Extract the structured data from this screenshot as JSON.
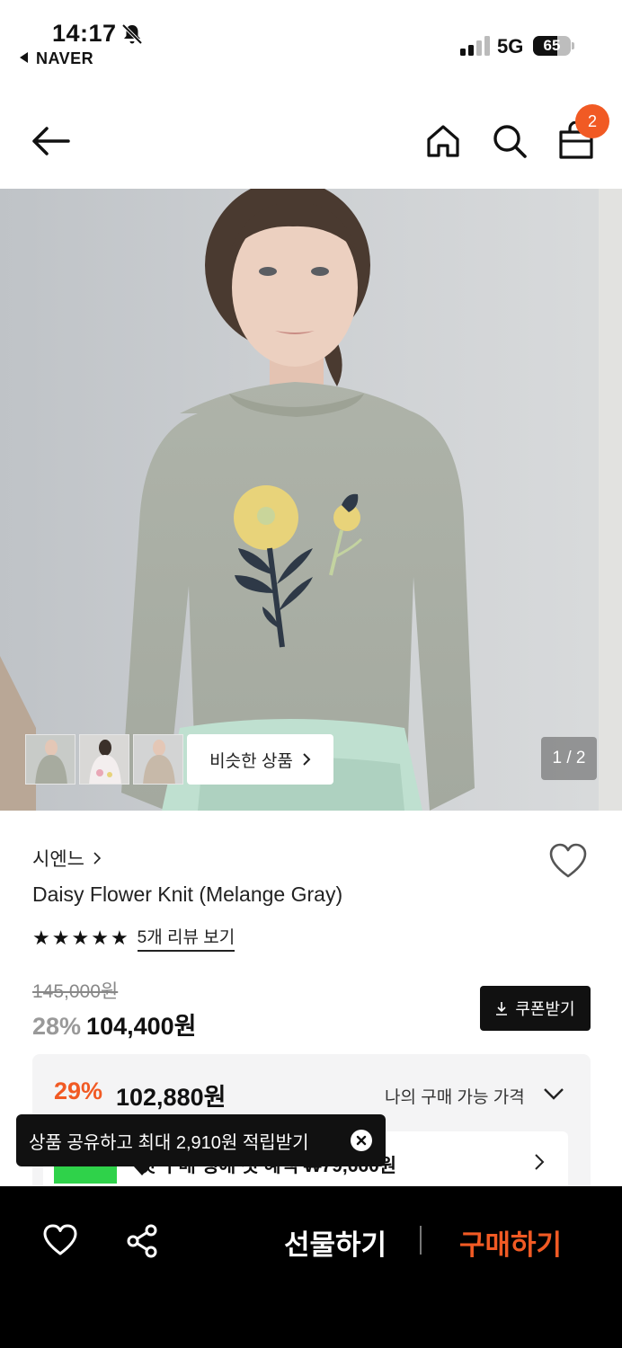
{
  "status_bar": {
    "time": "14:17",
    "back_app": "NAVER",
    "network": "5G",
    "battery": "65",
    "battery_level": 0.65
  },
  "nav": {
    "cart_count": "2"
  },
  "gallery": {
    "similar_label": "비슷한 상품",
    "pager": "1 / 2"
  },
  "product": {
    "brand": "시엔느",
    "name": "Daisy Flower Knit (Melange Gray)",
    "rating_stars": 5,
    "review_link": "5개 리뷰 보기",
    "original_price": "145,000원",
    "discount_rate": "28%",
    "price": "104,400원",
    "coupon_label": "쿠폰받기"
  },
  "my_price": {
    "rate": "29%",
    "price": "102,880원",
    "label": "나의 구매 가능 가격",
    "benefit_text": "첫 구매 생애 첫 혜택 ₩79,660원"
  },
  "toast": {
    "message": "상품 공유하고 최대 2,910원 적립받기"
  },
  "bottom_bar": {
    "gift_label": "선물하기",
    "buy_label": "구매하기"
  },
  "colors": {
    "accent": "#f15a24",
    "dark": "#111111"
  }
}
